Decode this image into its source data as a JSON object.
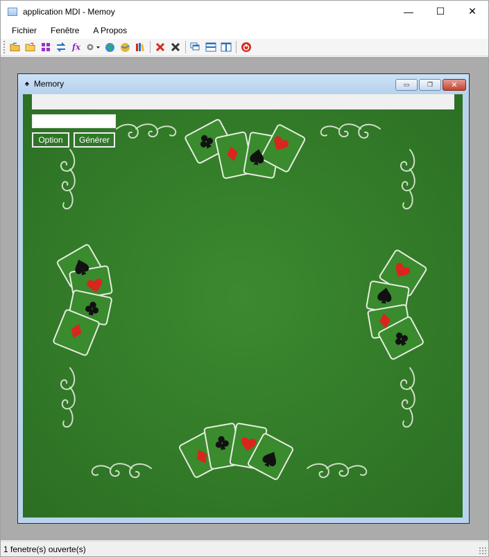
{
  "window": {
    "title": "application MDI - Memoy",
    "controls": {
      "minimize": "—",
      "maximize": "☐",
      "close": "✕"
    }
  },
  "menu": [
    "Fichier",
    "Fenêtre",
    "A Propos"
  ],
  "toolbar": {
    "icons": [
      "open-folder-icon",
      "folder-icon",
      "grid-icon",
      "swap-icon",
      "function-fx-icon",
      "gear-dropdown-icon",
      "globe-icon",
      "globe-2-icon",
      "books-icon",
      "delete-red-icon",
      "delete-black-icon",
      "cascade-windows-icon",
      "tile-horizontal-icon",
      "tile-vertical-icon",
      "exit-power-icon"
    ],
    "fx_label": "fx"
  },
  "child": {
    "title": "Memory",
    "controls": {
      "minimize": "▭",
      "restore": "❐",
      "close": "✕"
    },
    "input_value": "",
    "option_label": "Option",
    "generer_label": "Générer",
    "colors": {
      "felt": "#2f7526",
      "card_red": "#d9261c",
      "card_black": "#111111",
      "outline": "#e6ede0"
    }
  },
  "status": {
    "text": "1 fenetre(s) ouverte(s)"
  }
}
